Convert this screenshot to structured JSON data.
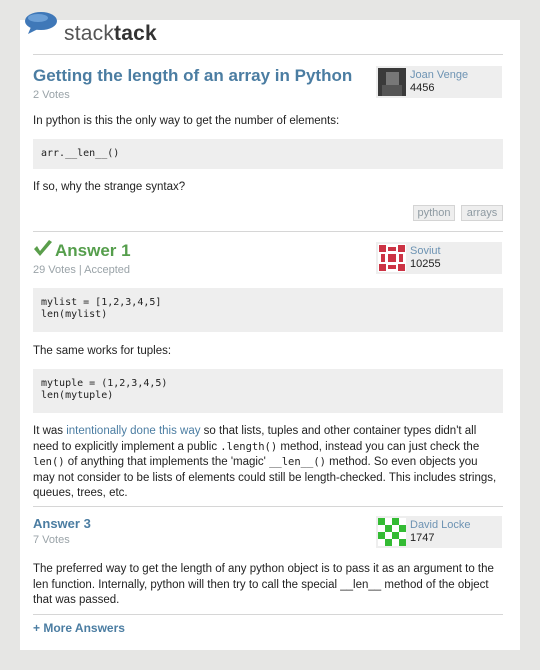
{
  "brand": {
    "prefix": "stack",
    "bold": "tack"
  },
  "question": {
    "title": "Getting the length of an array in Python",
    "votes": "2 Votes",
    "user": {
      "name": "Joan Venge",
      "rep": "4456"
    },
    "body_1": "In python is this the only way to get the number of elements:",
    "code": "arr.__len__()",
    "body_2": "If so, why the strange syntax?",
    "tags": [
      "python",
      "arrays"
    ]
  },
  "answer1": {
    "title": "Answer 1",
    "meta": "29 Votes | Accepted",
    "user": {
      "name": "Soviut",
      "rep": "10255"
    },
    "code_1": [
      "mylist = [1,2,3,4,5]",
      "len(mylist)"
    ],
    "text_1": "The same works for tuples:",
    "code_2": [
      "mytuple = (1,2,3,4,5)",
      "len(mytuple)"
    ],
    "p": {
      "t1": "It was ",
      "link": "intentionally done this way",
      "t2": " so that lists, tuples and other container types didn't all need to explicitly implement a public ",
      "c1": ".length()",
      "t3": " method, instead you can just check the ",
      "c2": "len()",
      "t4": " of anything that implements the 'magic' ",
      "c3": "__len__()",
      "t5": " method. So even objects you may not consider to be lists of elements could still be length-checked. This includes strings, queues, trees, etc."
    }
  },
  "answer3": {
    "title": "Answer 3",
    "votes": "7 Votes",
    "user": {
      "name": "David Locke",
      "rep": "1747"
    },
    "body": "The preferred way to get the length of any python object is to pass it as an argument to the len function. Internally, python will then try to call the special __len__ method of the object that was passed."
  },
  "more_answers": "+ More Answers"
}
